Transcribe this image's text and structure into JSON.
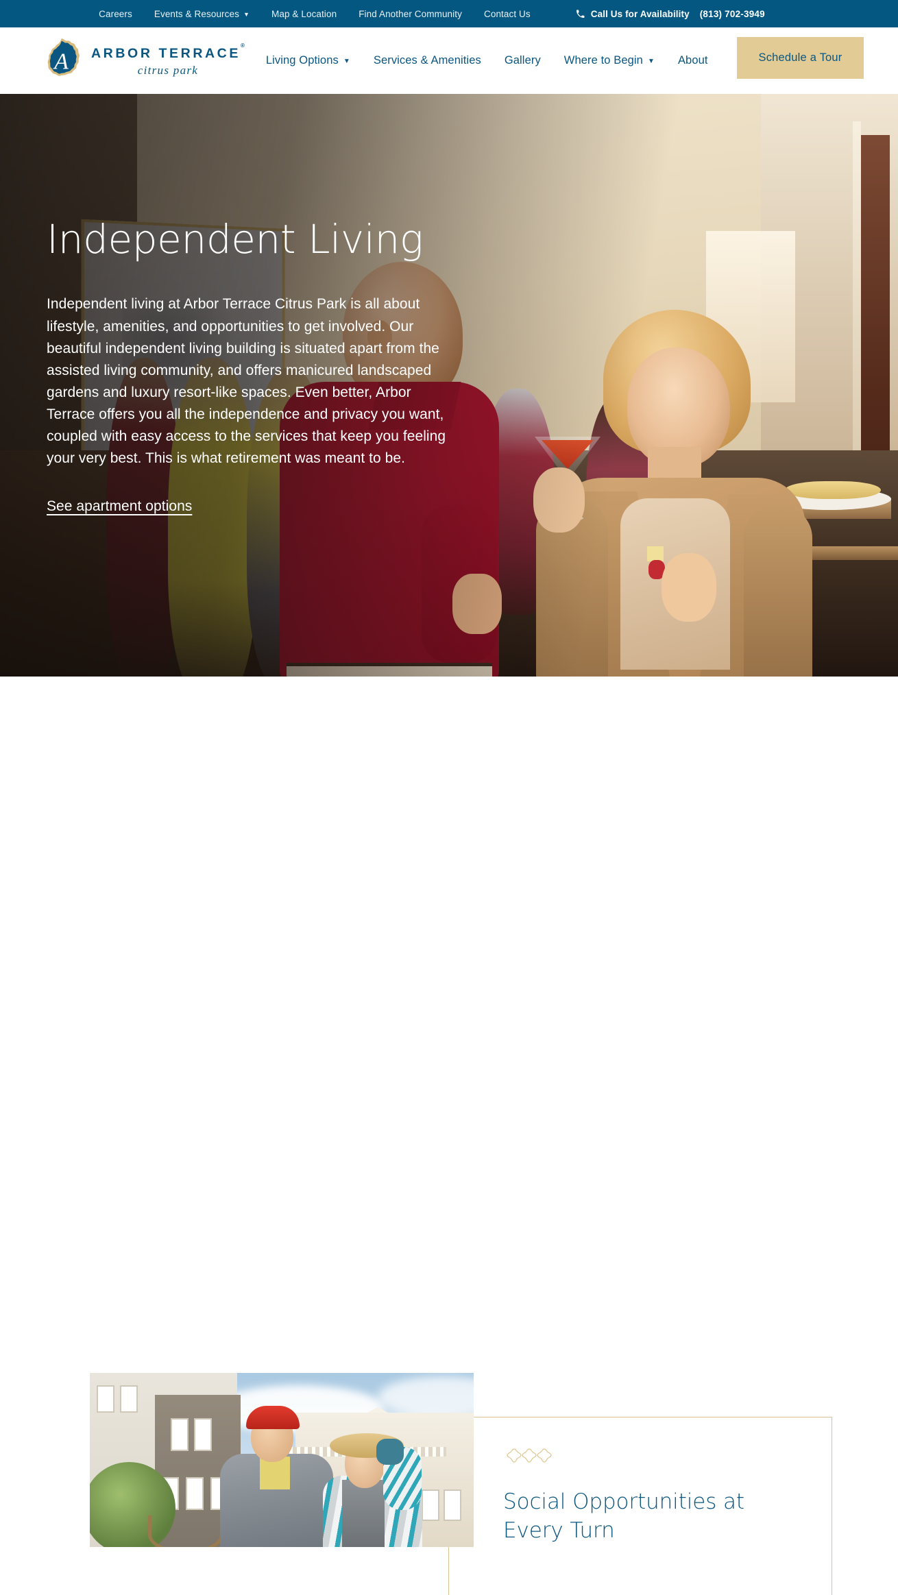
{
  "colors": {
    "brand_blue": "#045780",
    "text_blue": "#0a5680",
    "gold": "#e3cb96",
    "gold_line": "#dbc38d",
    "white": "#ffffff"
  },
  "utility_bar": {
    "links": [
      {
        "label": "Careers",
        "has_dropdown": false
      },
      {
        "label": "Events & Resources",
        "has_dropdown": true
      },
      {
        "label": "Map & Location",
        "has_dropdown": false
      },
      {
        "label": "Find Another Community",
        "has_dropdown": false
      },
      {
        "label": "Contact Us",
        "has_dropdown": false
      }
    ],
    "caret": "▼",
    "phone_icon": "phone-icon",
    "call_label": "Call Us for Availability",
    "phone_number": "(813) 702-3949"
  },
  "header": {
    "logo": {
      "monogram": "A",
      "name": "ARBOR TERRACE",
      "trademark": "®",
      "subtitle": "citrus park"
    },
    "nav": [
      {
        "label": "Living Options",
        "has_dropdown": true
      },
      {
        "label": "Services & Amenities",
        "has_dropdown": false
      },
      {
        "label": "Gallery",
        "has_dropdown": false
      },
      {
        "label": "Where to Begin",
        "has_dropdown": true
      },
      {
        "label": "About",
        "has_dropdown": false
      }
    ],
    "caret": "▼",
    "cta_label": "Schedule a Tour"
  },
  "hero": {
    "title": "Independent Living",
    "paragraph": "Independent living at Arbor Terrace Citrus Park is all about lifestyle, amenities, and opportunities to get involved. Our beautiful independent living building is situated apart from the assisted living community, and offers manicured landscaped gardens and luxury resort-like spaces. Even better, Arbor Terrace offers you all the independence and privacy you want, coupled with easy access to the services that keep you feeling your very best. This is what retirement was meant to be.",
    "link_label": "See apartment options",
    "scroll_icon": "arrow-down-icon"
  },
  "feature": {
    "ornament_icon": "quatrefoil-ornament-icon",
    "photo_alt": "senior-couple-outdoors-photo",
    "title": "Social Opportunities at Every Turn"
  }
}
